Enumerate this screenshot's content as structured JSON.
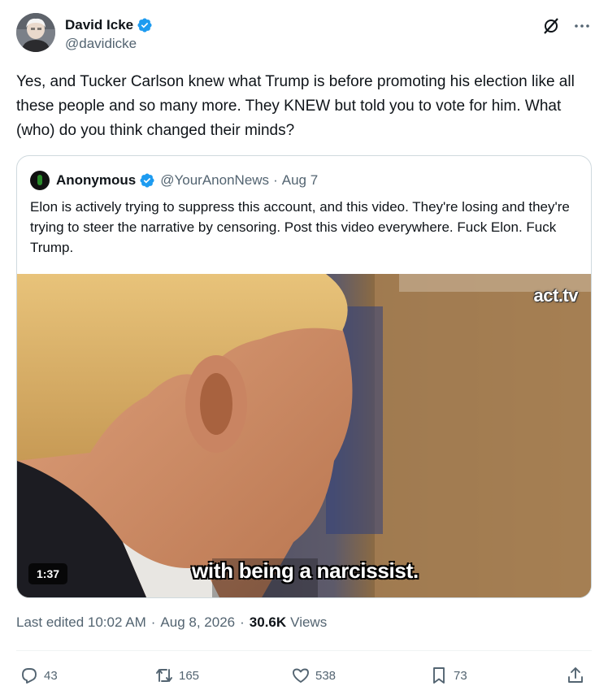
{
  "author": {
    "display_name": "David Icke",
    "handle": "@davidicke",
    "verified_color": "#1d9bf0"
  },
  "tweet": {
    "text": "Yes, and Tucker Carlson knew what Trump is before promoting his election like all these people and so many more. They KNEW but told you to vote for him. What (who) do you think changed their minds?"
  },
  "quoted": {
    "display_name": "Anonymous",
    "handle": "@YourAnonNews",
    "dot": "·",
    "date": "Aug 7",
    "text": "Elon is actively trying to suppress this account, and this video. They're losing and they're trying to steer the narrative by censoring. Post this video everywhere. Fuck Elon. Fuck Trump.",
    "video": {
      "watermark": "act.tv",
      "duration": "1:37",
      "caption": "with being a narcissist."
    }
  },
  "meta": {
    "edited": "Last edited 10:02 AM",
    "sep1": "·",
    "date": "Aug 8, 2026",
    "sep2": "·",
    "views_count": "30.6K",
    "views_label": "Views"
  },
  "actions": {
    "replies": "43",
    "reposts": "165",
    "likes": "538",
    "bookmarks": "73"
  },
  "icons": {
    "grok": "grok-icon",
    "more": "more-icon",
    "reply": "reply-icon",
    "repost": "repost-icon",
    "like": "heart-icon",
    "bookmark": "bookmark-icon",
    "share": "share-icon"
  }
}
